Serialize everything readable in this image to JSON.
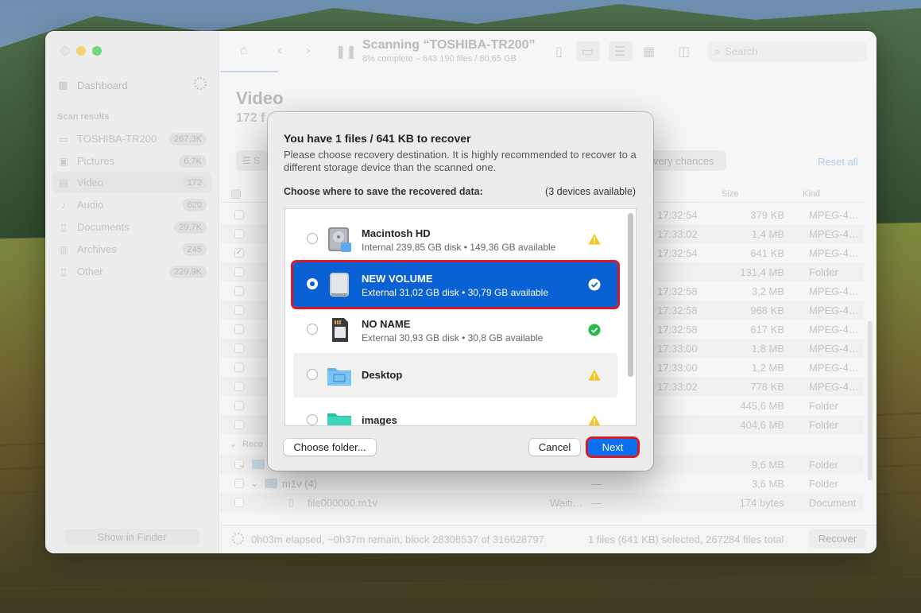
{
  "window": {
    "title": "Scanning “TOSHIBA-TR200”",
    "subtitle": "8% complete – 643 190 files / 80,65 GB",
    "search_placeholder": "Search"
  },
  "sidebar": {
    "dashboard_label": "Dashboard",
    "section_label": "Scan results",
    "items": [
      {
        "label": "TOSHIBA-TR200",
        "count": "267,3K",
        "icon": "drive-icon"
      },
      {
        "label": "Pictures",
        "count": "6,7K",
        "icon": "picture-icon"
      },
      {
        "label": "Video",
        "count": "172",
        "icon": "film-icon"
      },
      {
        "label": "Audio",
        "count": "620",
        "icon": "music-note-icon"
      },
      {
        "label": "Documents",
        "count": "29,7K",
        "icon": "document-icon"
      },
      {
        "label": "Archives",
        "count": "245",
        "icon": "archive-icon"
      },
      {
        "label": "Other",
        "count": "229,9K",
        "icon": "file-icon"
      }
    ],
    "show_in_finder": "Show in Finder"
  },
  "main": {
    "title": "Video",
    "subtitle": "172 f",
    "filter_label": "S",
    "chances_label": "very chances",
    "reset_all": "Reset all",
    "columns": {
      "size": "Size",
      "kind": "Kind"
    },
    "rows": [
      {
        "time": "17:32:54",
        "size": "379 KB",
        "kind": "MPEG-4…",
        "checked": false
      },
      {
        "time": "17:33:02",
        "size": "1,4 MB",
        "kind": "MPEG-4…",
        "checked": false
      },
      {
        "time": "17:32:54",
        "size": "641 KB",
        "kind": "MPEG-4…",
        "checked": true
      },
      {
        "time": "",
        "size": "131,4 MB",
        "kind": "Folder",
        "checked": false
      },
      {
        "time": "17:32:58",
        "size": "3,2 MB",
        "kind": "MPEG-4…",
        "checked": false
      },
      {
        "time": "17:32:58",
        "size": "968 KB",
        "kind": "MPEG-4…",
        "checked": false
      },
      {
        "time": "17:32:58",
        "size": "617 KB",
        "kind": "MPEG-4…",
        "checked": false
      },
      {
        "time": "17:33:00",
        "size": "1,8 MB",
        "kind": "MPEG-4…",
        "checked": false
      },
      {
        "time": "17:33:00",
        "size": "1,2 MB",
        "kind": "MPEG-4…",
        "checked": false
      },
      {
        "time": "17:33:02",
        "size": "778 KB",
        "kind": "MPEG-4…",
        "checked": false
      },
      {
        "time": "",
        "size": "445,6 MB",
        "kind": "Folder",
        "checked": false
      },
      {
        "time": "",
        "size": "404,6 MB",
        "kind": "Folder",
        "checked": false
      }
    ],
    "group_label": "Reco",
    "group_rows": [
      {
        "name": "",
        "status": "",
        "dash": "",
        "size": "9,6 MB",
        "kind": "Folder"
      },
      {
        "name": "m1v (4)",
        "status": "",
        "dash": "—",
        "size": "3,6 MB",
        "kind": "Folder"
      },
      {
        "name": "file000000.m1v",
        "status": "Waiti…",
        "dash": "—",
        "size": "174 bytes",
        "kind": "Document"
      }
    ]
  },
  "status_bar": {
    "elapsed": "0h03m elapsed, ~0h37m remain, block 28308537 of 316628797",
    "selection": "1 files (641 KB) selected, 267284 files total",
    "recover": "Recover"
  },
  "dialog": {
    "title": "You have 1 files / 641 KB to recover",
    "description": "Please choose recovery destination. It is highly recommended to recover to a different storage device than the scanned one.",
    "choose_label": "Choose where to save the recovered data:",
    "devices_available": "(3 devices available)",
    "destinations": [
      {
        "name": "Macintosh HD",
        "info": "Internal 239,85 GB disk • 149,36 GB available",
        "icon": "internal-disk-icon",
        "status": "warning-icon"
      },
      {
        "name": "NEW VOLUME",
        "info": "External 31,02 GB disk • 30,79 GB available",
        "icon": "external-disk-icon",
        "status": "check-icon"
      },
      {
        "name": "NO NAME",
        "info": "External 30,93 GB disk • 30,8 GB available",
        "icon": "sd-card-icon",
        "status": "check-icon"
      },
      {
        "name": "Desktop",
        "info": "",
        "icon": "desktop-folder-icon",
        "status": "warning-icon"
      },
      {
        "name": "images",
        "info": "",
        "icon": "folder-icon",
        "status": "warning-icon"
      }
    ],
    "selected_index": 1,
    "choose_folder": "Choose folder...",
    "cancel": "Cancel",
    "next": "Next"
  }
}
